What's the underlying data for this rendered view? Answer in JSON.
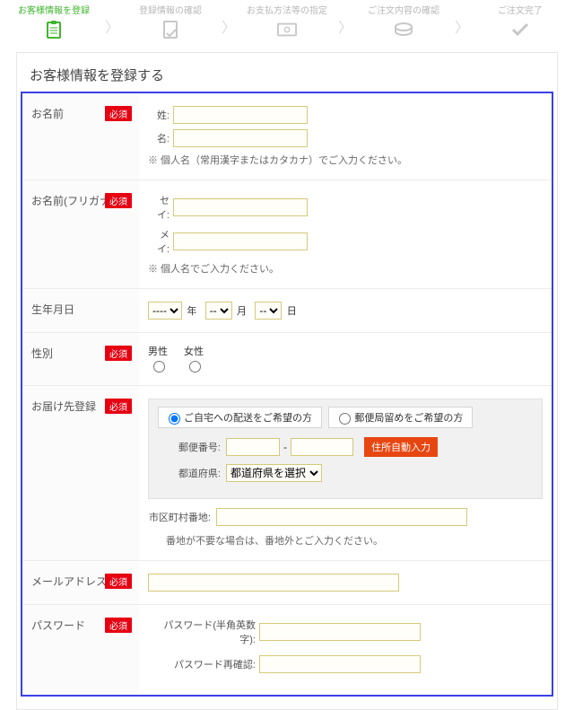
{
  "steps": {
    "s1": "お客様情報を登録",
    "s2": "登録情報の確認",
    "s3": "お支払方法等の指定",
    "s4": "ご注文内容の確認",
    "s5": "ご注文完了"
  },
  "title": "お客様情報を登録する",
  "required_label": "必須",
  "sections": {
    "name": {
      "label": "お名前",
      "lastname": "姓:",
      "firstname": "名:",
      "note": "※ 個人名（常用漢字またはカタカナ）でご入力ください。"
    },
    "kana": {
      "label": "お名前(フリガナ)",
      "lastname": "セイ:",
      "firstname": "メイ:",
      "note": "※ 個人名でご入力ください。"
    },
    "birth": {
      "label": "生年月日",
      "year_default": "----",
      "month_default": "--",
      "day_default": "--",
      "year_unit": "年",
      "month_unit": "月",
      "day_unit": "日"
    },
    "gender": {
      "label": "性別",
      "male": "男性",
      "female": "女性"
    },
    "address": {
      "label": "お届け先登録",
      "tab_home": "ご自宅への配送をご希望の方",
      "tab_office": "郵便局留めをご希望の方",
      "zip_label": "郵便番号:",
      "zip_sep": "-",
      "pref_label": "都道府県:",
      "pref_default": "都道府県を選択",
      "auto_btn": "住所自動入力",
      "city_label": "市区町村番地:",
      "city_note": "番地が不要な場合は、番地外とご入力ください。"
    },
    "email": {
      "label": "メールアドレス"
    },
    "password": {
      "label": "パスワード",
      "pw1": "パスワード(半角英数字):",
      "pw2": "パスワード再確認:"
    }
  }
}
